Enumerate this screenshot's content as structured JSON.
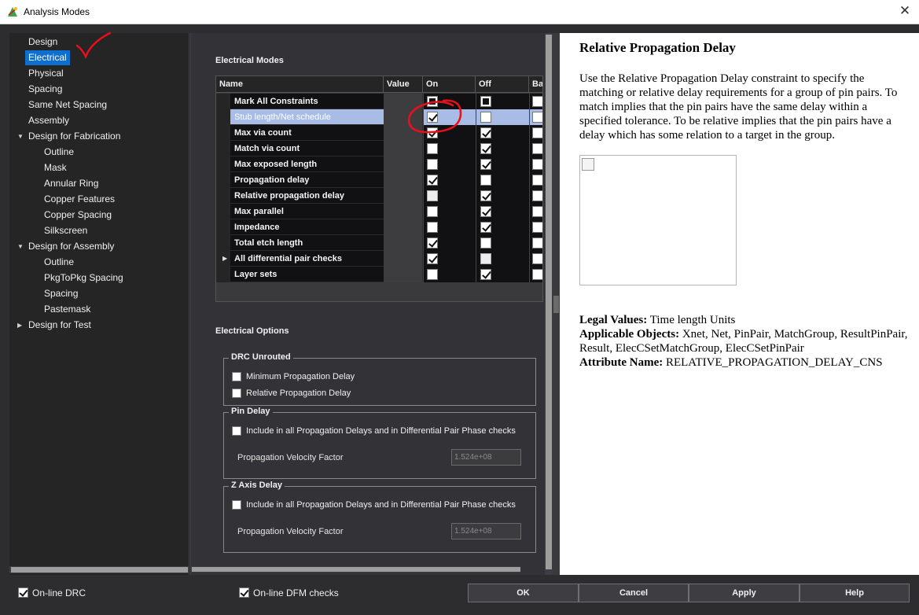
{
  "window": {
    "title": "Analysis Modes",
    "close_glyph": "✕",
    "icon": "app-icon"
  },
  "nav": {
    "items": [
      {
        "label": "Design",
        "selected": false
      },
      {
        "label": "Electrical",
        "selected": true
      },
      {
        "label": "Physical",
        "selected": false
      },
      {
        "label": "Spacing",
        "selected": false
      },
      {
        "label": "Same Net Spacing",
        "selected": false
      },
      {
        "label": "Assembly",
        "selected": false
      },
      {
        "label": "Design for Fabrication",
        "selected": false,
        "expanded": true
      },
      {
        "label": "Outline",
        "selected": false
      },
      {
        "label": "Mask",
        "selected": false
      },
      {
        "label": "Annular Ring",
        "selected": false
      },
      {
        "label": "Copper Features",
        "selected": false
      },
      {
        "label": "Copper Spacing",
        "selected": false
      },
      {
        "label": "Silkscreen",
        "selected": false
      },
      {
        "label": "Design for Assembly",
        "selected": false,
        "expanded": true
      },
      {
        "label": "Outline",
        "selected": false
      },
      {
        "label": "PkgToPkg Spacing",
        "selected": false
      },
      {
        "label": "Spacing",
        "selected": false
      },
      {
        "label": "Pastemask",
        "selected": false
      },
      {
        "label": "Design for Test",
        "selected": false,
        "expanded": false
      }
    ]
  },
  "electrical_modes": {
    "title": "Electrical Modes",
    "columns": [
      "Name",
      "Value",
      "On",
      "Off",
      "Ba"
    ],
    "rows": [
      {
        "name": "Mark All Constraints",
        "on": "indeterminate",
        "off": "indeterminate",
        "ba": "unchecked"
      },
      {
        "name": "Stub length/Net schedule",
        "on": "checked",
        "off": "unchecked",
        "ba": "unchecked",
        "selected": true
      },
      {
        "name": "Max via count",
        "on": "checked",
        "off": "checked",
        "ba": "unchecked"
      },
      {
        "name": "Match via count",
        "on": "unchecked",
        "off": "checked",
        "ba": "unchecked"
      },
      {
        "name": "Max exposed length",
        "on": "unchecked",
        "off": "checked",
        "ba": "unchecked"
      },
      {
        "name": "Propagation delay",
        "on": "checked",
        "off": "unchecked",
        "ba": "unchecked"
      },
      {
        "name": "Relative propagation delay",
        "on": "disabled",
        "off": "checked",
        "ba": "unchecked"
      },
      {
        "name": "Max parallel",
        "on": "unchecked",
        "off": "checked",
        "ba": "unchecked"
      },
      {
        "name": "Impedance",
        "on": "unchecked",
        "off": "checked",
        "ba": "unchecked"
      },
      {
        "name": "Total etch length",
        "on": "checked",
        "off": "unchecked",
        "ba": "unchecked"
      },
      {
        "name": "All differential pair checks",
        "on": "checked",
        "off": "disabled",
        "ba": "unchecked",
        "expandable": true
      },
      {
        "name": "Layer sets",
        "on": "unchecked",
        "off": "checked",
        "ba": "unchecked"
      }
    ]
  },
  "electrical_options": {
    "title": "Electrical Options",
    "drc_unrouted": {
      "title": "DRC Unrouted",
      "options": [
        "Minimum Propagation Delay",
        "Relative Propagation Delay"
      ]
    },
    "pin_delay": {
      "title": "Pin Delay",
      "include_label": "Include in all Propagation Delays and in Differential Pair Phase checks",
      "velocity_label": "Propagation Velocity Factor",
      "velocity_value": "1.524e+08"
    },
    "z_axis_delay": {
      "title": "Z Axis Delay",
      "include_label": "Include in all Propagation Delays and in Differential Pair Phase checks",
      "velocity_label": "Propagation Velocity Factor",
      "velocity_value": "1.524e+08"
    }
  },
  "help": {
    "title": "Relative Propagation Delay",
    "description": "Use the Relative Propagation Delay constraint to specify the matching or relative delay requirements for a group of pin pairs. To match implies that the pin pairs have the same delay within a specified tolerance. To be relative implies that the pin pairs have a delay which has some relation to a target in the group.",
    "legal_values_label": "Legal Values:",
    "legal_values": "Time length Units",
    "applicable_objects_label": "Applicable Objects:",
    "applicable_objects": "Xnet, Net, PinPair, MatchGroup, ResultPinPair, Result, ElecCSetMatchGroup, ElecCSetPinPair",
    "attribute_name_label": "Attribute Name:",
    "attribute_name": "RELATIVE_PROPAGATION_DELAY_CNS"
  },
  "footer": {
    "online_drc": "On-line DRC",
    "online_dfm": "On-line DFM checks",
    "ok": "OK",
    "cancel": "Cancel",
    "apply": "Apply",
    "help": "Help"
  },
  "colors": {
    "selection_blue": "#0e6fce",
    "row_selected": "#a8bce6",
    "annotation_red": "#e8101a"
  }
}
